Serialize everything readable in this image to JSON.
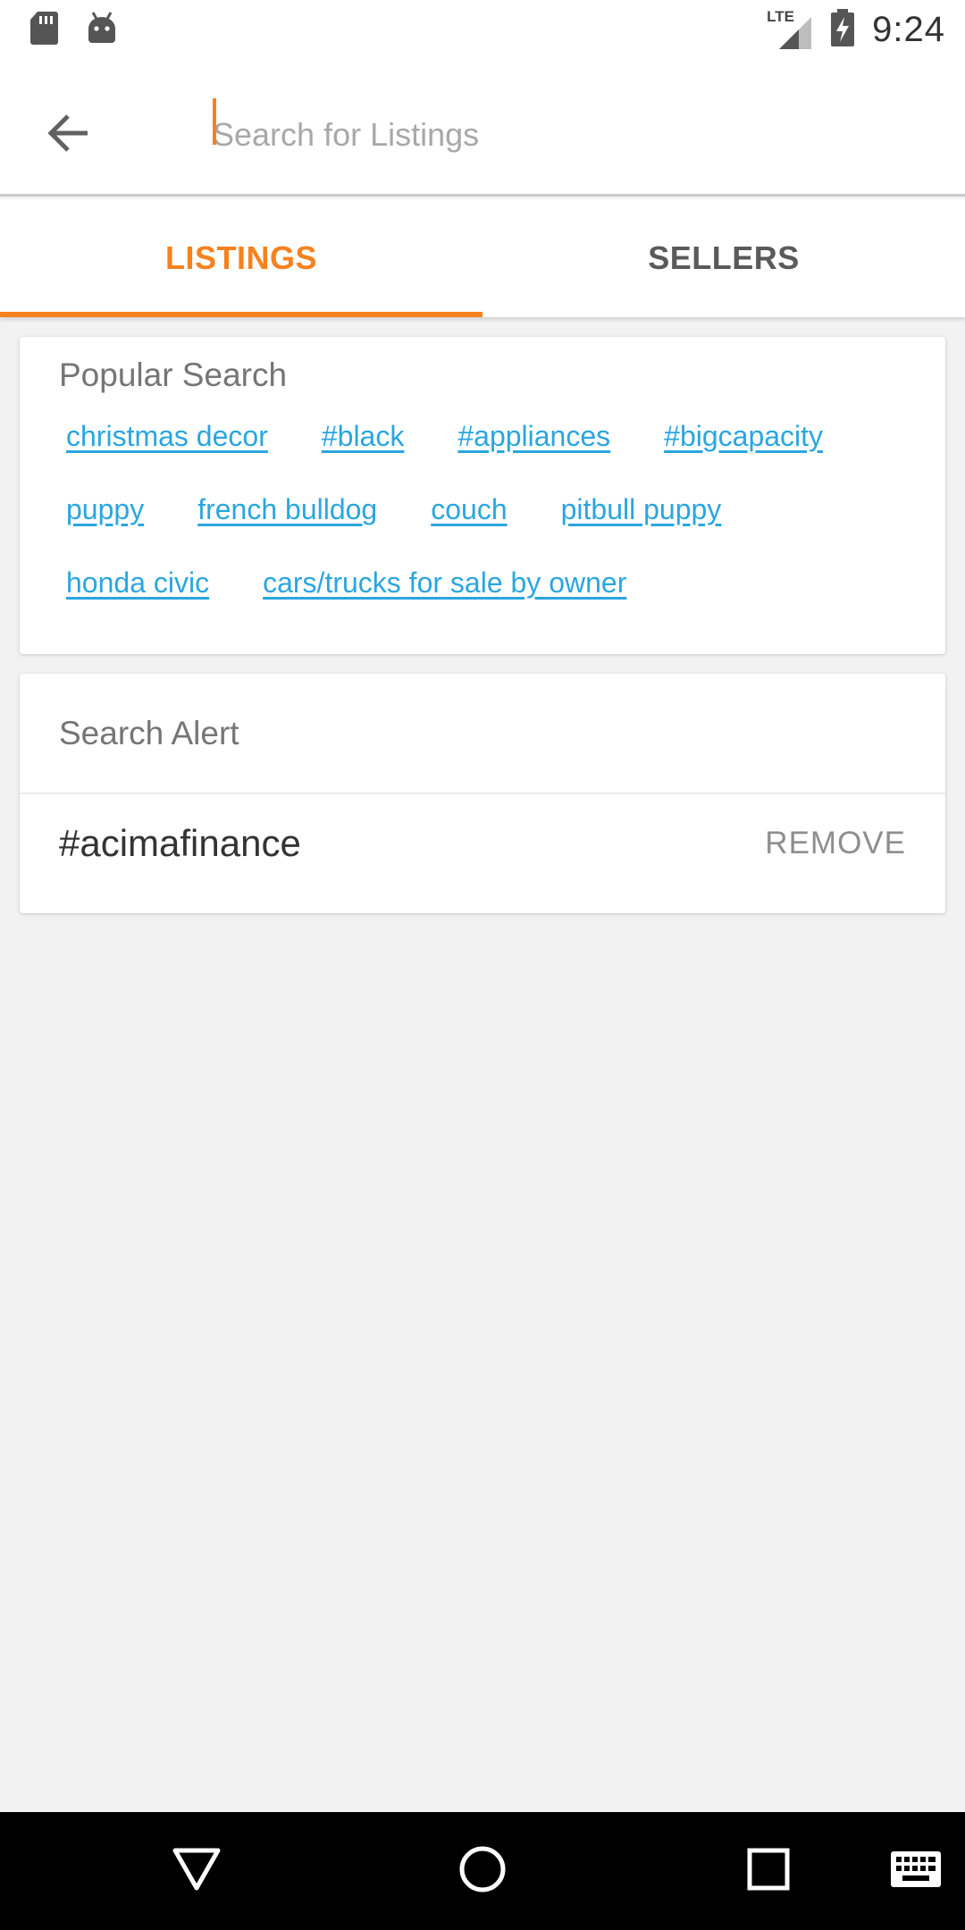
{
  "status_bar": {
    "time": "9:24",
    "network": "LTE",
    "icons": [
      "sd-card-icon",
      "android-icon",
      "signal-icon",
      "battery-charging-icon"
    ]
  },
  "search": {
    "placeholder": "Search for Listings",
    "value": ""
  },
  "tabs": [
    {
      "label": "LISTINGS",
      "active": true
    },
    {
      "label": "SELLERS",
      "active": false
    }
  ],
  "popular_search": {
    "title": "Popular Search",
    "rows": [
      [
        "christmas decor",
        "#black",
        "#appliances",
        "#bigcapacity"
      ],
      [
        "puppy",
        "french bulldog",
        "couch",
        "pitbull puppy"
      ],
      [
        "honda civic",
        "cars/trucks for sale by owner"
      ]
    ]
  },
  "search_alert": {
    "title": "Search Alert",
    "items": [
      {
        "term": "#acimafinance",
        "action": "REMOVE"
      }
    ]
  },
  "colors": {
    "accent": "#f5821f",
    "link": "#2aa6e0",
    "background": "#f2f2f2"
  },
  "nav_bar": {
    "icons": [
      "back-triangle-icon",
      "home-circle-icon",
      "recents-square-icon",
      "keyboard-icon"
    ]
  }
}
